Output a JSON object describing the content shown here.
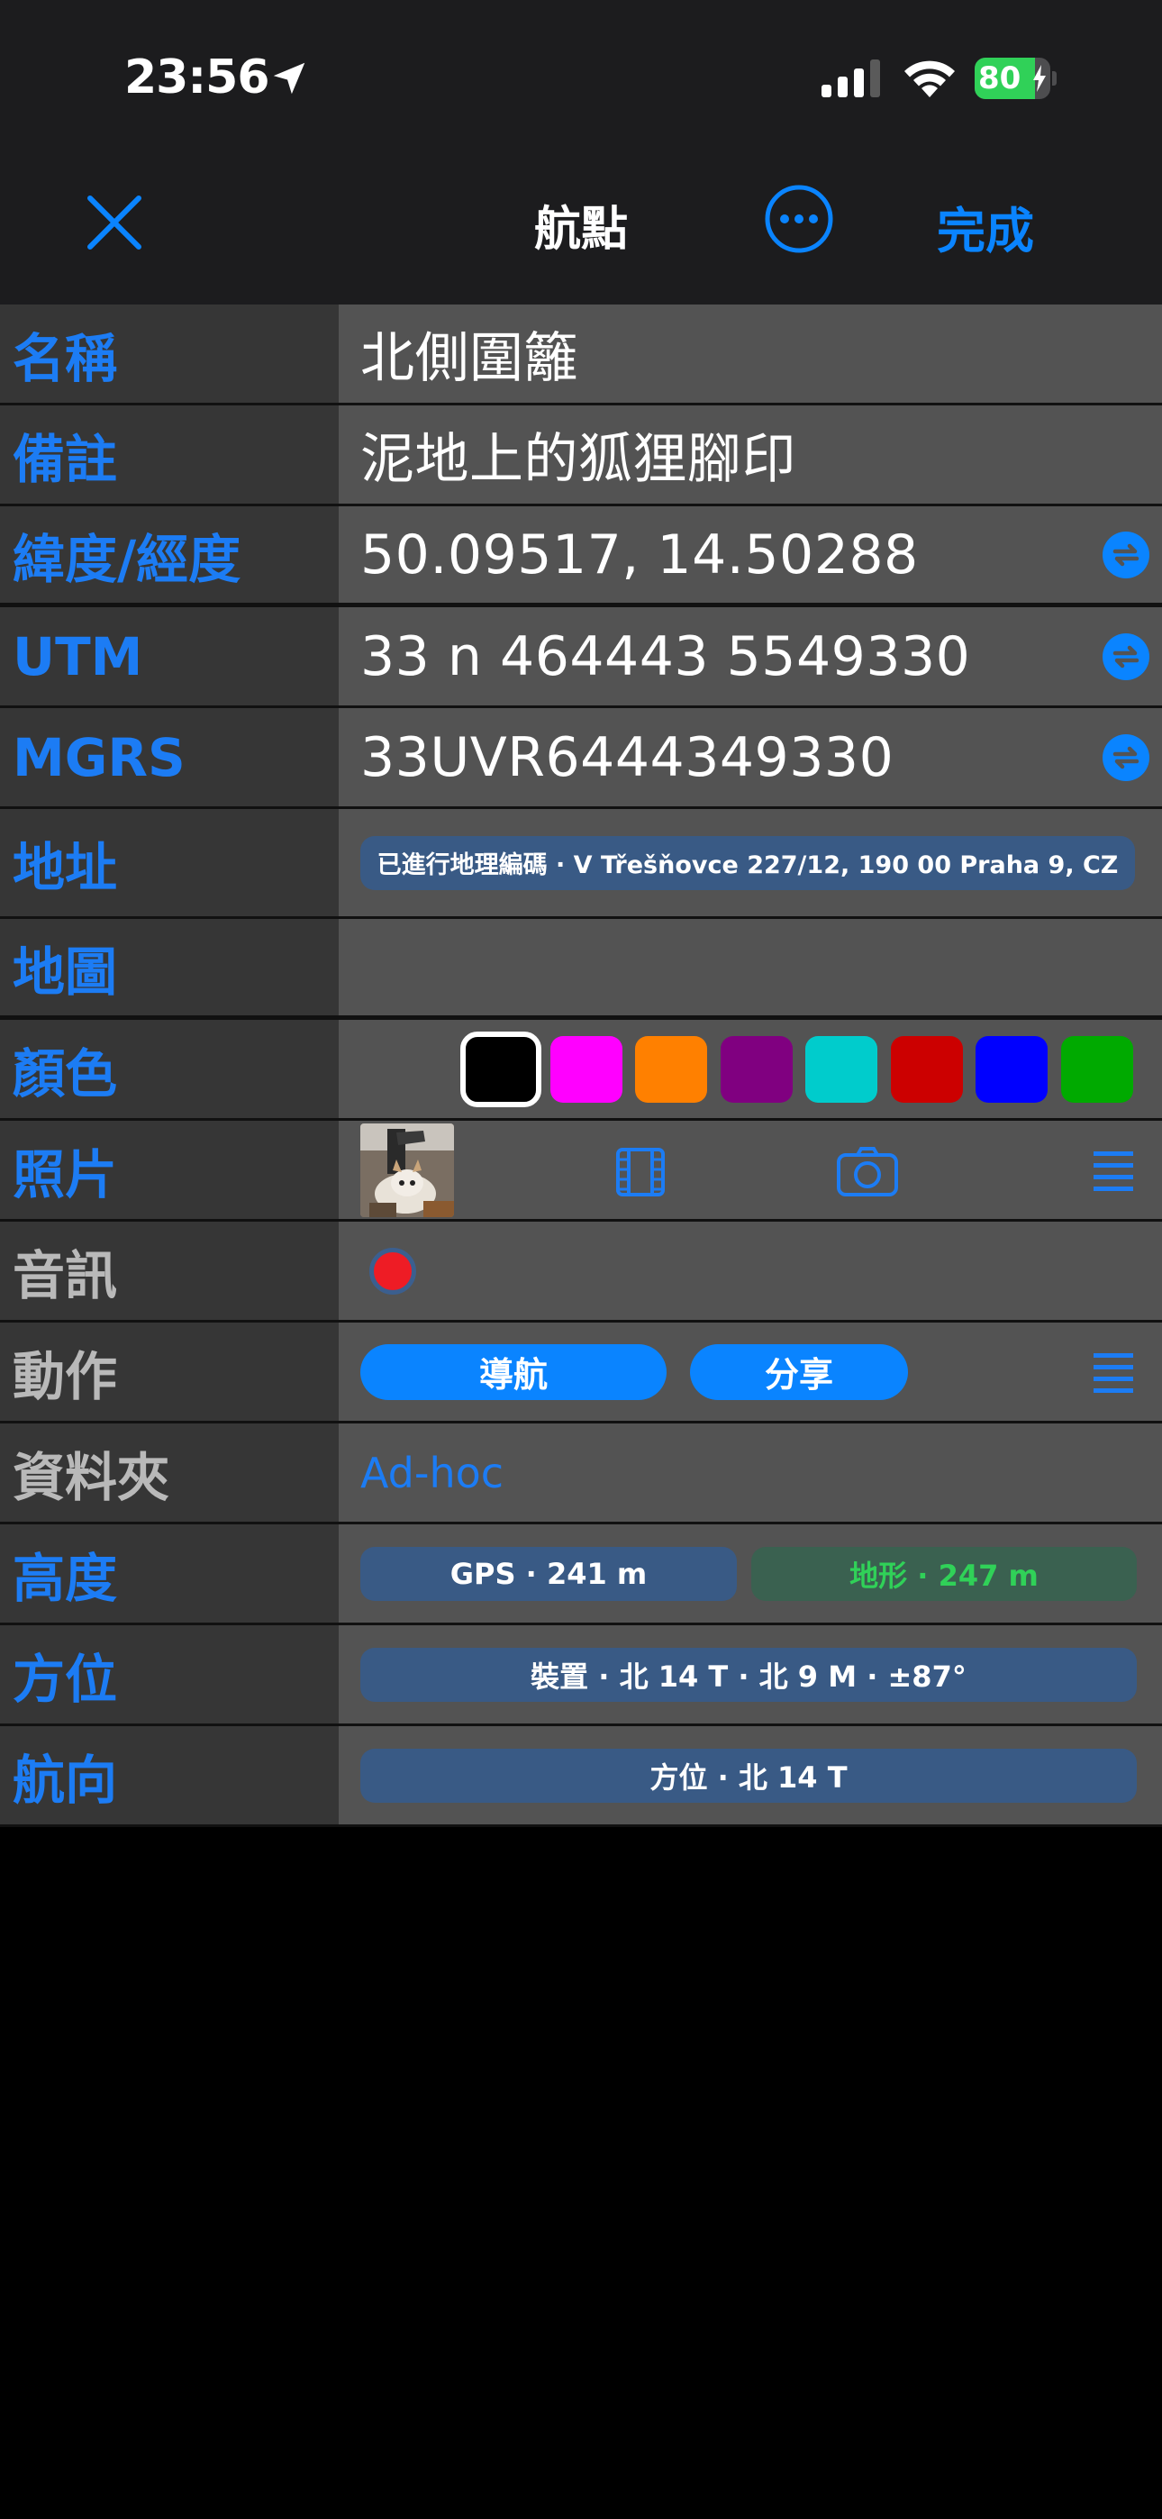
{
  "status_bar": {
    "time": "23:56",
    "battery_percent": 80,
    "battery_label": "80",
    "icons": [
      "location-arrow-icon",
      "cellular-signal-icon",
      "wifi-icon",
      "battery-charging-icon"
    ]
  },
  "nav": {
    "title": "航點",
    "done_label": "完成",
    "close_icon": "close-x-icon",
    "more_icon": "ellipsis-circle-icon"
  },
  "fields": {
    "name": {
      "label": "名稱",
      "value": "北側圍籬"
    },
    "note": {
      "label": "備註",
      "value": "泥地上的狐狸腳印"
    },
    "latlon": {
      "label": "緯度/經度",
      "value": "50.09517, 14.50288"
    },
    "utm": {
      "label": "UTM",
      "value": "33 n 464443 5549330"
    },
    "mgrs": {
      "label": "MGRS",
      "value": "33UVR6444349330"
    },
    "address": {
      "label": "地址",
      "value": "已進行地理編碼 · V Třešňovce 227/12, 190 00 Praha 9, CZ"
    },
    "map": {
      "label": "地圖"
    },
    "color": {
      "label": "顏色",
      "swatches": [
        "#000000",
        "#ff00ff",
        "#ff8000",
        "#800080",
        "#00cccc",
        "#cc0000",
        "#0000ff",
        "#00aa00"
      ],
      "selected": "#000000"
    },
    "photo": {
      "label": "照片"
    },
    "audio": {
      "label": "音訊"
    },
    "actions": {
      "label": "動作",
      "navigate": "導航",
      "share": "分享"
    },
    "folder": {
      "label": "資料夾",
      "value": "Ad-hoc"
    },
    "altitude": {
      "label": "高度",
      "gps": "GPS · 241 m",
      "terrain": "地形 · 247 m"
    },
    "bearing": {
      "label": "方位",
      "value": "裝置 · 北 14 T · 北 9 M · ±87°"
    },
    "heading": {
      "label": "航向",
      "value": "方位 · 北 14 T"
    }
  },
  "colors": {
    "accent": "#0a84ff",
    "label_blue": "#1c7cf4",
    "label_gray": "#b9b9b9",
    "pill_blue": "#395a85",
    "pill_green_text": "#30d158"
  }
}
